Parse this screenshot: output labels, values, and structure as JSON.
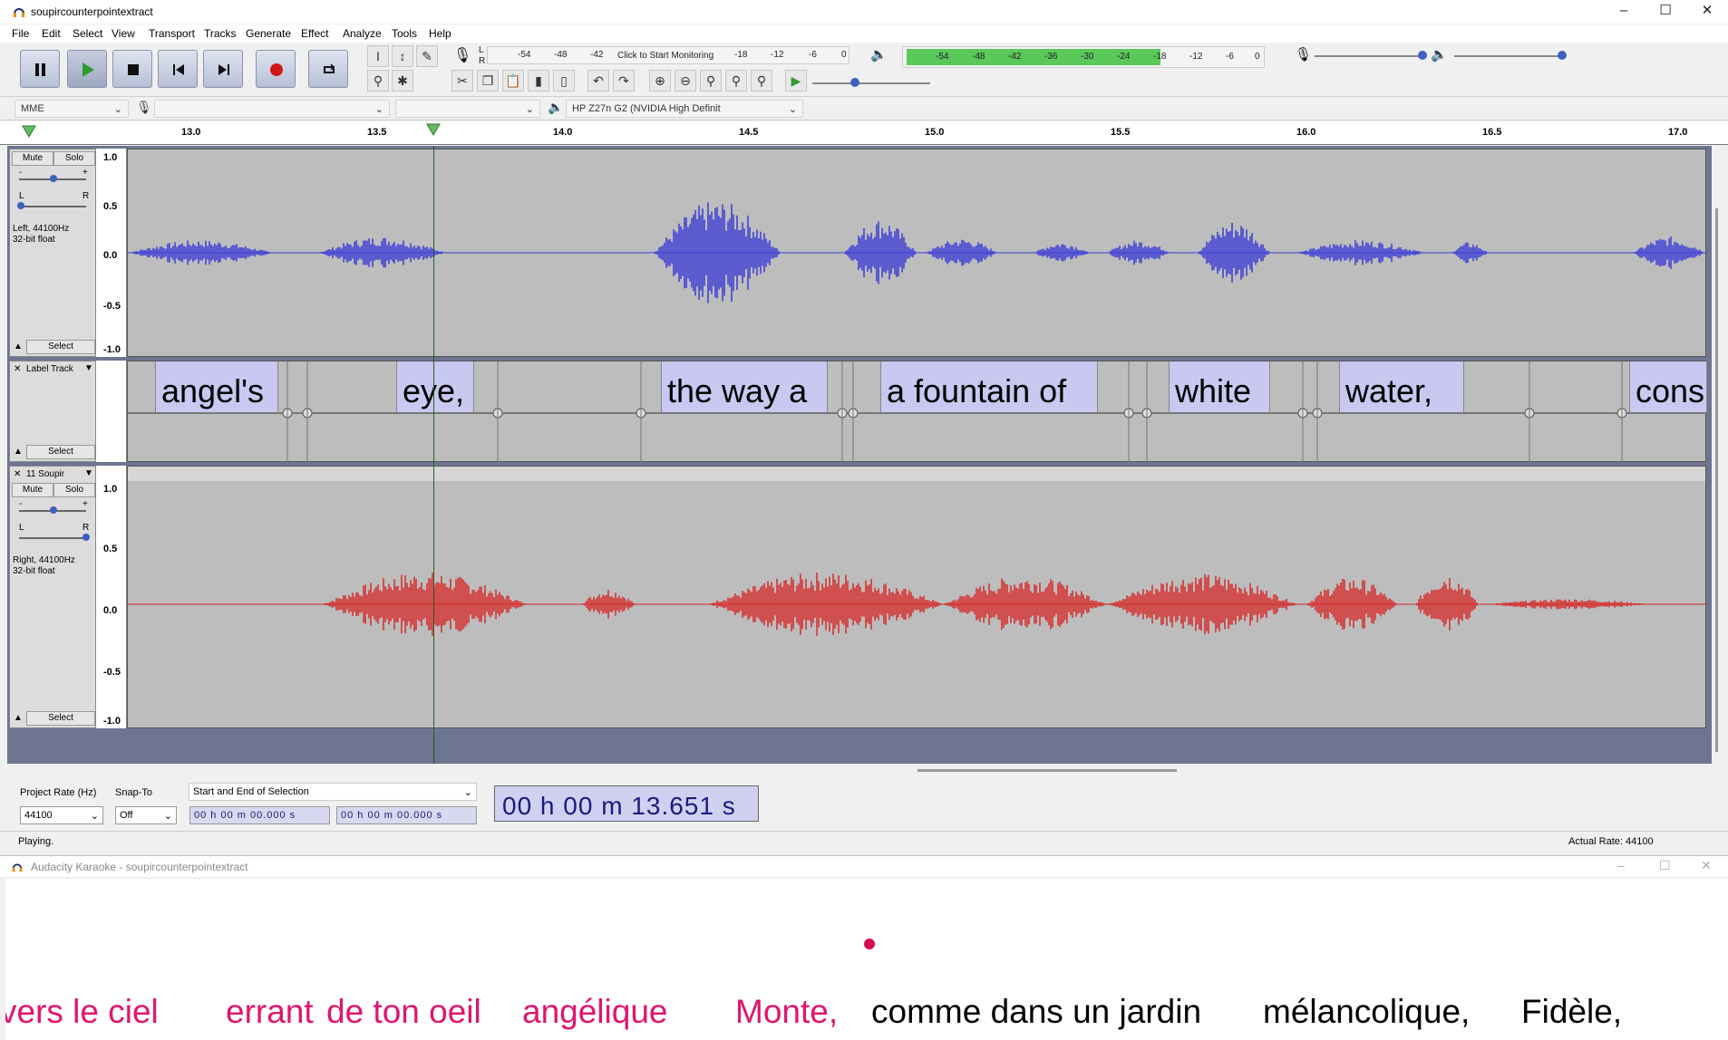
{
  "window": {
    "title": "soupircounterpointextract"
  },
  "menu": [
    "File",
    "Edit",
    "Select",
    "View",
    "Transport",
    "Tracks",
    "Generate",
    "Effect",
    "Analyze",
    "Tools",
    "Help"
  ],
  "meters": {
    "record_scale": [
      "-54",
      "-48",
      "-42",
      "Click to Start Monitoring",
      "-18",
      "-12",
      "-6",
      "0"
    ],
    "play_scale": [
      "-54",
      "-48",
      "-42",
      "-36",
      "-30",
      "-24",
      "-18",
      "-12",
      "-6",
      "0"
    ],
    "lr": [
      "L",
      "R"
    ]
  },
  "device": {
    "host": "MME",
    "output": "HP Z27n G2 (NVIDIA High Definit"
  },
  "ruler": [
    "13.0",
    "13.5",
    "14.0",
    "14.5",
    "15.0",
    "15.5",
    "16.0",
    "16.5",
    "17.0"
  ],
  "tracks": {
    "left": {
      "mute": "Mute",
      "solo": "Solo",
      "gain_min": "-",
      "gain_max": "+",
      "pan_l": "L",
      "pan_r": "R",
      "info1": "Left, 44100Hz",
      "info2": "32-bit float",
      "select": "Select",
      "scale": [
        "1.0",
        "0.5",
        "0.0",
        "-0.5",
        "-1.0"
      ]
    },
    "label": {
      "name": "Label Track",
      "select": "Select",
      "labels": [
        "angel's",
        "eye,",
        "the way a",
        "a fountain of",
        "white",
        "water,",
        "cons"
      ]
    },
    "right": {
      "name": "11 Soupir",
      "mute": "Mute",
      "solo": "Solo",
      "gain_min": "-",
      "gain_max": "+",
      "pan_l": "L",
      "pan_r": "R",
      "info1": "Right, 44100Hz",
      "info2": "32-bit float",
      "select": "Select",
      "scale": [
        "1.0",
        "0.5",
        "0.0",
        "-0.5",
        "-1.0"
      ]
    }
  },
  "bottom": {
    "project_rate_label": "Project Rate (Hz)",
    "project_rate": "44100",
    "snap_to_label": "Snap-To",
    "snap_to": "Off",
    "selection_mode": "Start and End of Selection",
    "sel_start": "00 h 00 m 00.000 s",
    "sel_end": "00 h 00 m 00.000 s",
    "time": "00 h 00 m 13.651 s"
  },
  "status": {
    "left": "Playing.",
    "right": "Actual Rate: 44100"
  },
  "karaoke": {
    "title": "Audacity Karaoke - soupircounterpointextract",
    "sung": [
      "vers le ciel",
      "errant",
      "de ton oeil",
      "angélique",
      "Monte,"
    ],
    "unsung": [
      "comme dans un jardin",
      "mélancolique,",
      "Fidèle,"
    ],
    "colors": {
      "sung": "#e0156e",
      "unsung": "#000000",
      "ball": "#d01050"
    }
  },
  "colors": {
    "left_wave": "#3b3bd6",
    "right_wave": "#d62a2a",
    "track_bg": "#bdbdbd",
    "label_bg": "#c8c8f0"
  }
}
